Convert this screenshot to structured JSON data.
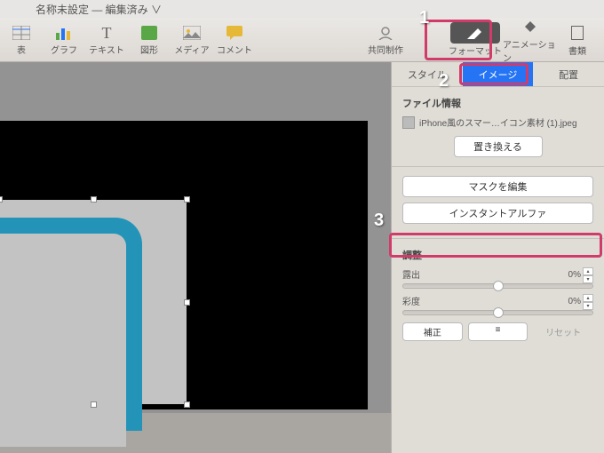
{
  "title": "名称未設定 — 編集済み ∨",
  "toolbar": {
    "table": "表",
    "chart": "グラフ",
    "text": "テキスト",
    "shape": "図形",
    "media": "メディア",
    "comment": "コメント",
    "collab": "共同制作",
    "format": "フォーマット",
    "animation": "アニメーション",
    "document": "書類"
  },
  "tabs": {
    "style": "スタイル",
    "image": "イメージ",
    "arrange": "配置"
  },
  "fileinfo": {
    "title": "ファイル情報",
    "name": "iPhone風のスマー…イコン素材 (1).jpeg",
    "replace": "置き換える"
  },
  "mask": {
    "edit": "マスクを編集",
    "alpha": "インスタントアルファ"
  },
  "adjust": {
    "title": "調整",
    "exposure": "露出",
    "saturation": "彩度",
    "exposure_val": "0%",
    "saturation_val": "0%",
    "correct": "補正",
    "levels_icon": "≡",
    "reset": "リセット"
  },
  "annotations": {
    "n1": "1",
    "n2": "2",
    "n3": "3"
  }
}
